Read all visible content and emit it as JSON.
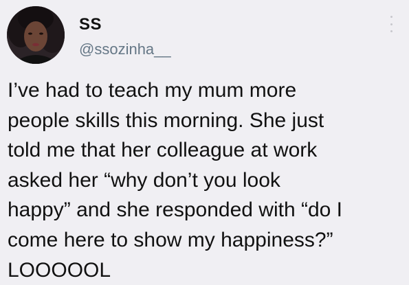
{
  "tweet": {
    "user": {
      "display_name": "SS",
      "handle": "@ssozinha__",
      "avatar_icon": "profile-photo"
    },
    "more_icon": "more-vertical-icon",
    "text": "I’ve had to teach my mum more\npeople skills this morning. She just\ntold me that her colleague at work\nasked her “why don’t you look\nhappy” and she responded with “do I\ncome here to show my happiness?”\nLOOOOOL"
  },
  "colors": {
    "background": "#f0eff3",
    "text": "#111111",
    "handle": "#657786"
  }
}
